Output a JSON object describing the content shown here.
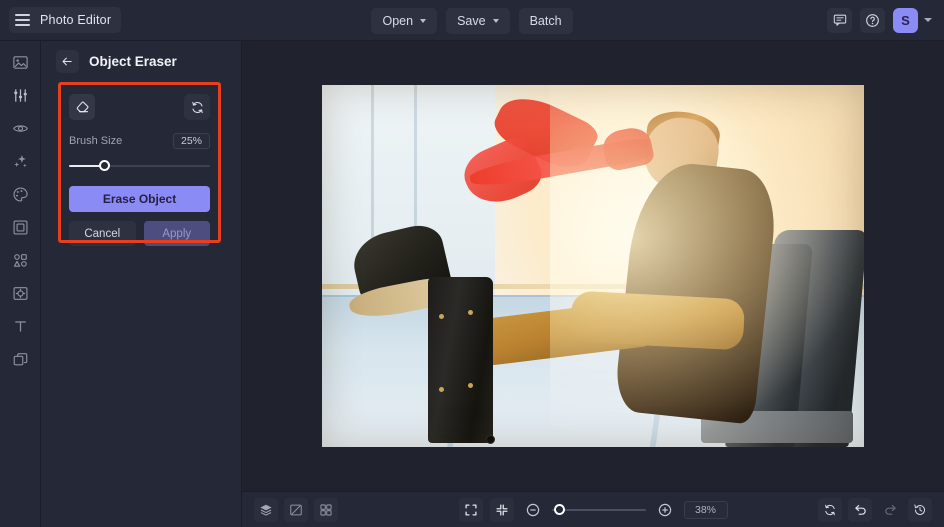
{
  "topbar": {
    "brand": "Photo Editor",
    "menu_icon": "hamburger-icon",
    "buttons": [
      {
        "label": "Open",
        "has_chevron": true
      },
      {
        "label": "Save",
        "has_chevron": true
      },
      {
        "label": "Batch",
        "has_chevron": false
      }
    ],
    "right_icons": [
      "feedback-icon",
      "help-icon"
    ],
    "avatar_initial": "S",
    "avatar_color": "#8b8bf5"
  },
  "rail": {
    "items": [
      {
        "name": "image-icon"
      },
      {
        "name": "adjustments-icon"
      },
      {
        "name": "retouch-eye-icon"
      },
      {
        "name": "effects-sparkle-icon"
      },
      {
        "name": "color-palette-icon"
      },
      {
        "name": "crop-frame-icon"
      },
      {
        "name": "shapes-icon"
      },
      {
        "name": "overlay-icon"
      },
      {
        "name": "text-icon"
      },
      {
        "name": "layers-stack-icon"
      }
    ]
  },
  "panel": {
    "title": "Object Eraser",
    "back_icon": "arrow-left-icon",
    "eraser_icon": "eraser-icon",
    "reset_icon": "reset-refresh-icon",
    "brush_size_label": "Brush Size",
    "brush_size_value": "25%",
    "brush_size_percent": 25,
    "erase_button": "Erase Object",
    "cancel_button": "Cancel",
    "apply_button": "Apply",
    "highlight_color": "#e8401f",
    "accent_color": "#8b8bf5"
  },
  "canvas": {
    "photo_description": "Man relaxing in an airport lounge chair with feet on a black suitcase; red paint mask over a toy airplane"
  },
  "bottombar": {
    "left_icons": [
      "layers-icon",
      "compare-icon",
      "grid-icon"
    ],
    "center_icons": [
      "fit-screen-icon",
      "actual-size-icon",
      "zoom-out-icon",
      "zoom-in-icon"
    ],
    "zoom_value": "38%",
    "zoom_slider_percent": 9,
    "right_icons": [
      "reset-icon",
      "undo-icon",
      "redo-icon",
      "history-icon"
    ]
  }
}
